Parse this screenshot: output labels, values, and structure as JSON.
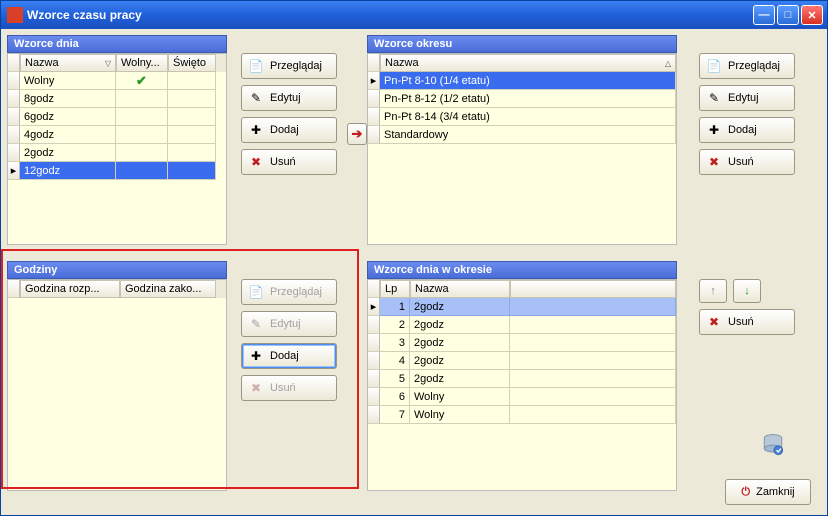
{
  "window": {
    "title": "Wzorce czasu pracy"
  },
  "buttons": {
    "browse": "Przeglądaj",
    "edit": "Edytuj",
    "add": "Dodaj",
    "delete": "Usuń",
    "close": "Zamknij"
  },
  "panel_day": {
    "title": "Wzorce dnia",
    "cols": {
      "name": "Nazwa",
      "free": "Wolny...",
      "holiday": "Święto"
    },
    "rows": [
      {
        "name": "Wolny",
        "free": true,
        "holiday": false,
        "selected": false
      },
      {
        "name": "8godz",
        "free": false,
        "holiday": false,
        "selected": false
      },
      {
        "name": "6godz",
        "free": false,
        "holiday": false,
        "selected": false
      },
      {
        "name": "4godz",
        "free": false,
        "holiday": false,
        "selected": false
      },
      {
        "name": "2godz",
        "free": false,
        "holiday": false,
        "selected": false
      },
      {
        "name": "12godz",
        "free": false,
        "holiday": false,
        "selected": true
      }
    ]
  },
  "panel_period": {
    "title": "Wzorce okresu",
    "cols": {
      "name": "Nazwa"
    },
    "rows": [
      {
        "name": "Pn-Pt 8-10 (1/4 etatu)",
        "selected": true
      },
      {
        "name": "Pn-Pt 8-12 (1/2 etatu)",
        "selected": false
      },
      {
        "name": "Pn-Pt 8-14 (3/4 etatu)",
        "selected": false
      },
      {
        "name": "Standardowy",
        "selected": false
      }
    ]
  },
  "panel_hours": {
    "title": "Godziny",
    "cols": {
      "start": "Godzina rozp...",
      "end": "Godzina zako..."
    }
  },
  "panel_days_in_period": {
    "title": "Wzorce dnia w okresie",
    "cols": {
      "lp": "Lp",
      "name": "Nazwa"
    },
    "rows": [
      {
        "lp": "1",
        "name": "2godz",
        "selected": true
      },
      {
        "lp": "2",
        "name": "2godz",
        "selected": false
      },
      {
        "lp": "3",
        "name": "2godz",
        "selected": false
      },
      {
        "lp": "4",
        "name": "2godz",
        "selected": false
      },
      {
        "lp": "5",
        "name": "2godz",
        "selected": false
      },
      {
        "lp": "6",
        "name": "Wolny",
        "selected": false
      },
      {
        "lp": "7",
        "name": "Wolny",
        "selected": false
      }
    ]
  }
}
